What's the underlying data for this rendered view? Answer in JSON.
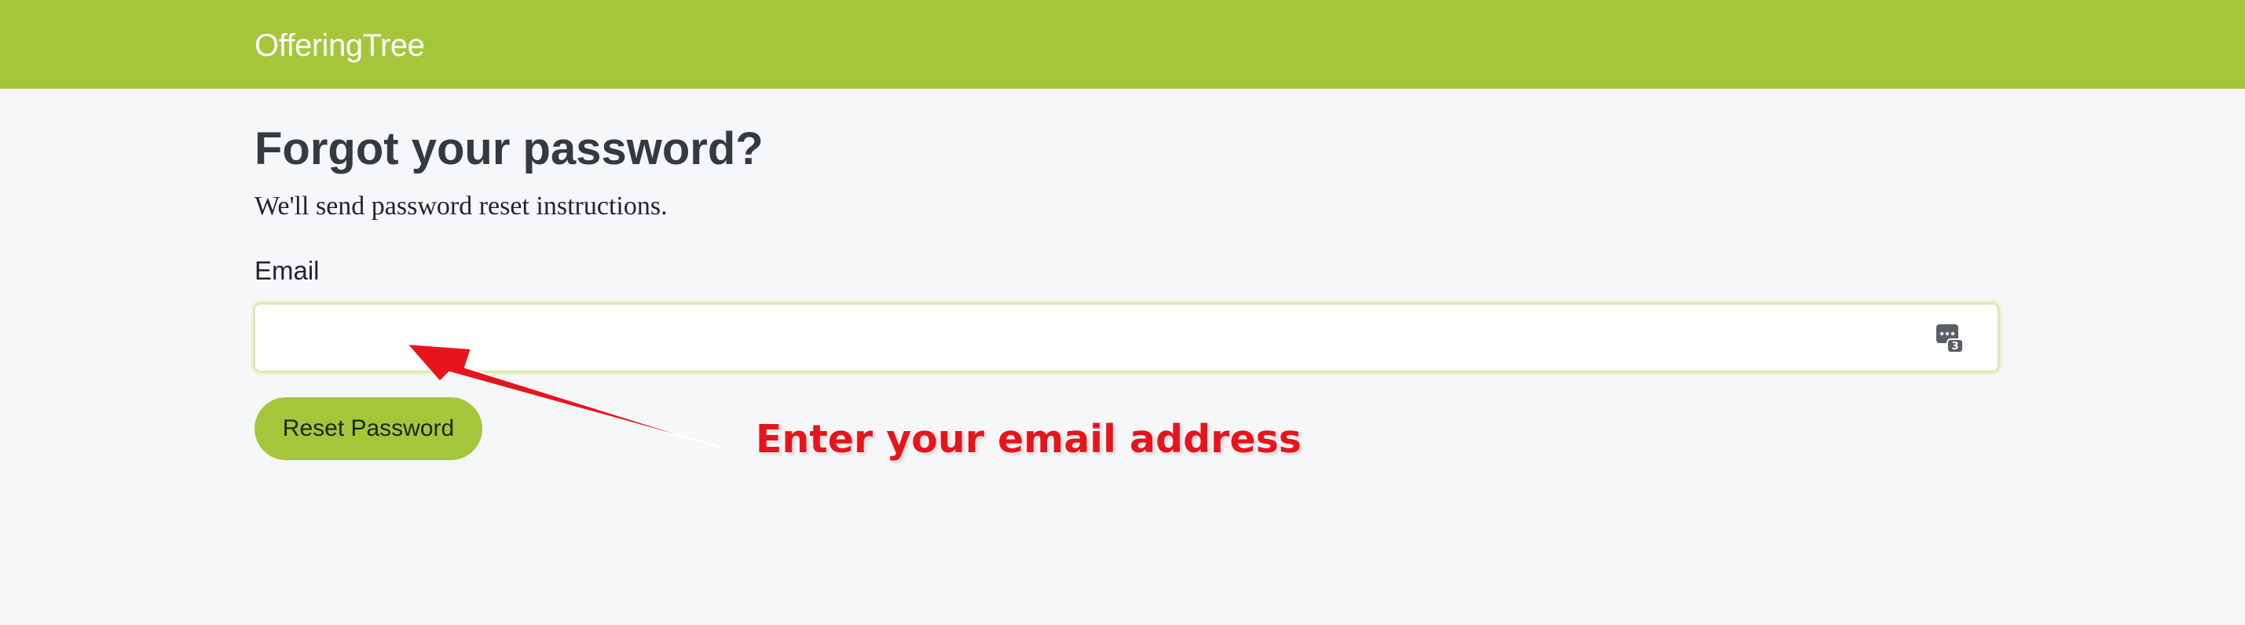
{
  "header": {
    "brand": "OfferingTree"
  },
  "main": {
    "title": "Forgot your password?",
    "subtitle": "We'll send password reset instructions.",
    "email_label": "Email",
    "email_value": "",
    "submit_label": "Reset Password"
  },
  "annotation": {
    "callout_text": "Enter your email address"
  },
  "icons": {
    "password_manager": "password-manager-icon",
    "arrow": "red-arrow"
  },
  "colors": {
    "brand_green": "#a5c63b",
    "page_background": "#f6f7f9",
    "annotation_red": "#e8141c"
  }
}
